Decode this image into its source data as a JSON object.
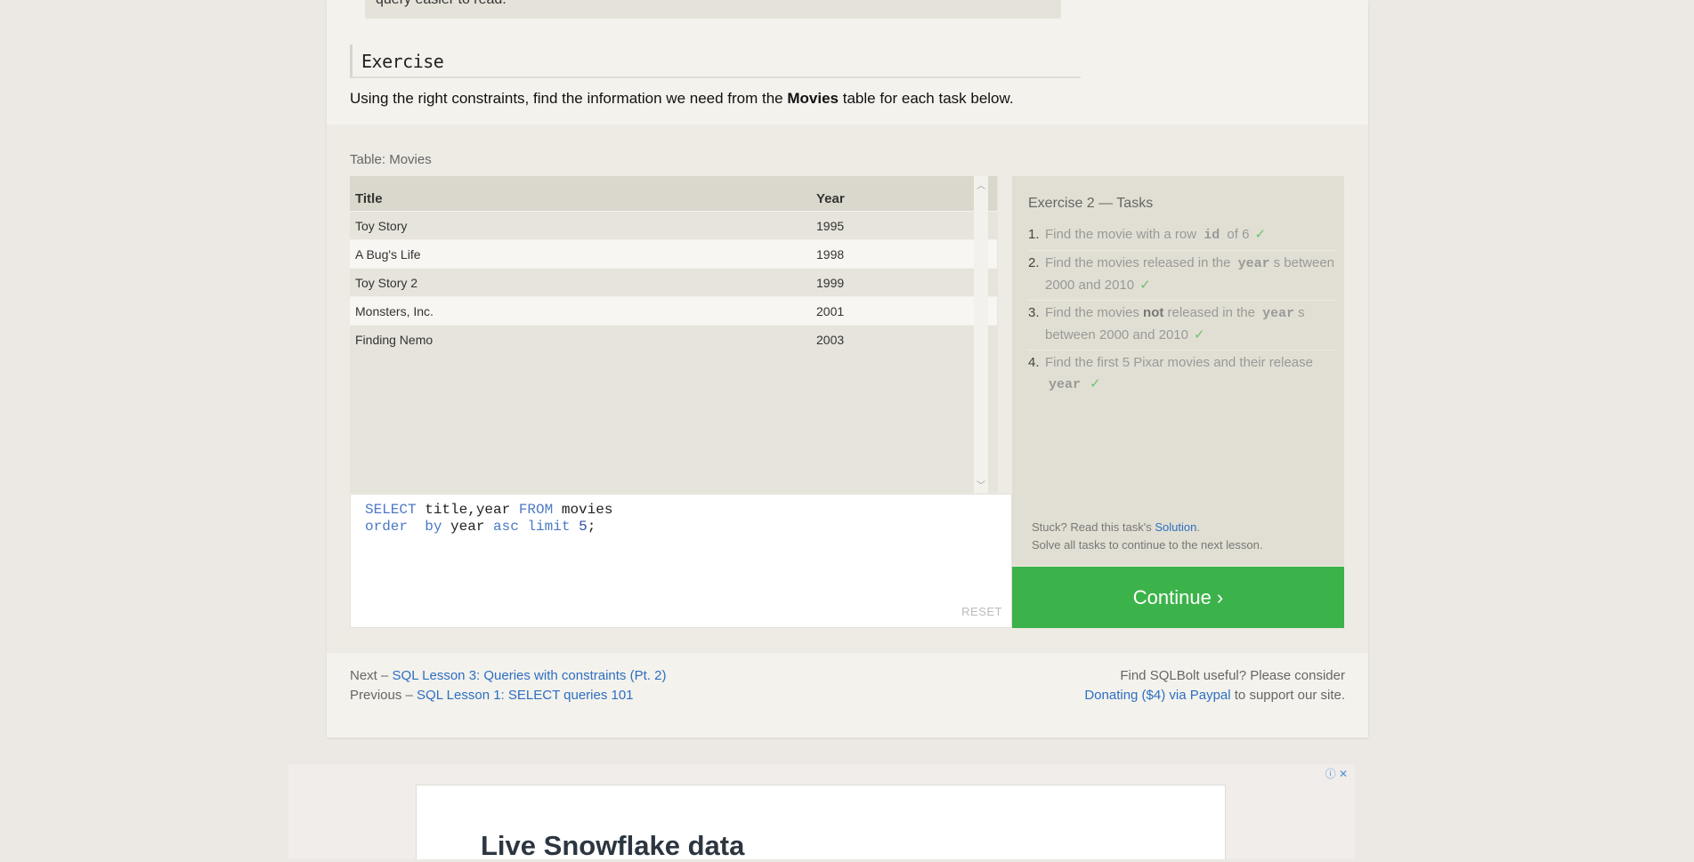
{
  "prev_text": "query easier to read.",
  "exercise_heading": "Exercise",
  "intro": {
    "before": "Using the right constraints, find the information we need from the ",
    "bold": "Movies",
    "after": " table for each task below."
  },
  "table": {
    "caption": "Table: Movies",
    "headers": [
      "Title",
      "Year"
    ],
    "rows": [
      [
        "Toy Story",
        "1995"
      ],
      [
        "A Bug's Life",
        "1998"
      ],
      [
        "Toy Story 2",
        "1999"
      ],
      [
        "Monsters, Inc.",
        "2001"
      ],
      [
        "Finding Nemo",
        "2003"
      ]
    ]
  },
  "editor": {
    "line1": {
      "kw1": "SELECT",
      "t1": " title,year ",
      "kw2": "FROM",
      "t2": " movies"
    },
    "line2": {
      "kw1": "order",
      "t1": "  ",
      "kw2": "by",
      "t2": " year ",
      "kw3": "asc",
      "t3": " ",
      "kw4": "limit",
      "t4": " ",
      "num": "5",
      "t5": ";"
    },
    "reset_label": "RESET"
  },
  "tasks": {
    "title": "Exercise 2 — Tasks",
    "items": [
      {
        "n": "1.",
        "a": "Find the movie with a row ",
        "code": "id",
        "b": " of 6"
      },
      {
        "n": "2.",
        "a": "Find the movies released in the ",
        "code": "year",
        "b": "s between 2000 and 2010"
      },
      {
        "n": "3.",
        "a": "Find the movies ",
        "bold": "not",
        "a2": " released in the ",
        "code": "year",
        "b": "s between 2000 and 2010"
      },
      {
        "n": "4.",
        "a": "Find the first 5 Pixar movies and their release ",
        "code": "year",
        "b": ""
      }
    ],
    "check": "✓",
    "stuck_text": "Stuck? Read this task's ",
    "solution_link": "Solution",
    "stuck_end": ".",
    "solve_all": "Solve all tasks to continue to the next lesson."
  },
  "continue_label": "Continue ›",
  "footer": {
    "next_prefix": "Next – ",
    "next_link": "SQL Lesson 3: Queries with constraints (Pt. 2)",
    "prev_prefix": "Previous – ",
    "prev_link": "SQL Lesson 1: SELECT queries 101",
    "useful": "Find SQLBolt useful? Please consider",
    "donate_link": "Donating ($4) via Paypal",
    "donate_suffix": " to support our site."
  },
  "ad": {
    "title": "Live Snowflake data",
    "info_icon": "info-icon",
    "close_icon": "close-icon"
  }
}
